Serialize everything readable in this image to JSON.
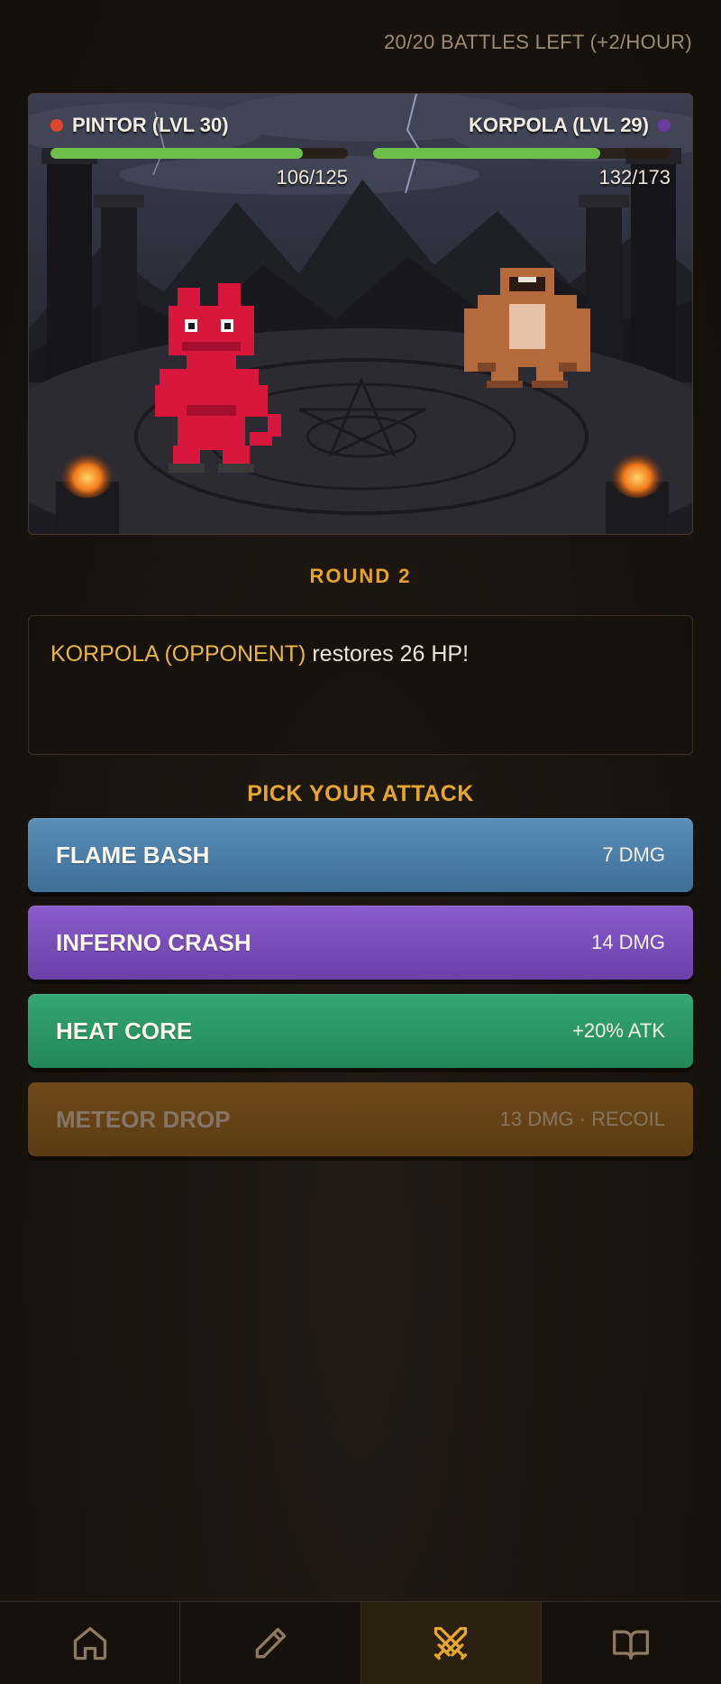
{
  "header": {
    "battles_left": "20/20 BATTLES LEFT (+2/HOUR)"
  },
  "player": {
    "label": "PINTOR (LVL 30)",
    "hp": "106/125",
    "hp_current": 106,
    "hp_max": 125,
    "dot_color": "#e0452a"
  },
  "opponent": {
    "label": "KORPOLA (LVL 29)",
    "hp": "132/173",
    "hp_current": 132,
    "hp_max": 173,
    "dot_color": "#6b3a9a"
  },
  "round": {
    "label": "ROUND 2"
  },
  "log": {
    "actor": "KORPOLA (OPPONENT)",
    "message": " restores 26 HP!"
  },
  "attacks": {
    "title": "PICK YOUR ATTACK",
    "items": [
      {
        "name": "FLAME BASH",
        "stat": "7 DMG",
        "color": "#4a7fa8",
        "enabled": true
      },
      {
        "name": "INFERNO CRASH",
        "stat": "14 DMG",
        "color": "#7a4fbe",
        "enabled": true
      },
      {
        "name": "HEAT CORE",
        "stat": "+20% ATK",
        "color": "#2a9865",
        "enabled": true
      },
      {
        "name": "METEOR DROP",
        "stat": "13 DMG · RECOIL",
        "color": "#654316",
        "enabled": false
      }
    ]
  },
  "nav": {
    "items": [
      {
        "icon": "home-icon"
      },
      {
        "icon": "pencil-icon"
      },
      {
        "icon": "crossed-swords-icon",
        "active": true
      },
      {
        "icon": "book-icon"
      }
    ],
    "active_color": "#e6a730",
    "icon_color": "#8d7a64"
  }
}
